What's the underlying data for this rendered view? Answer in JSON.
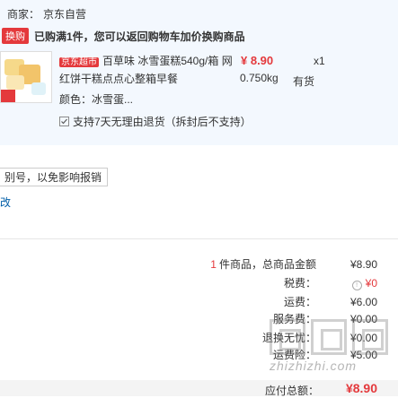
{
  "merchant": {
    "label": "商家：",
    "name": "京东自营"
  },
  "promo": {
    "badge": "换购",
    "text": "已购满1件，您可以返回购物车加价换购商品"
  },
  "product": {
    "store_badge": "京东超市",
    "title": "百草味 冰雪蛋糕540g/箱 网红饼干糕点点心整箱早餐",
    "price": "¥ 8.90",
    "quantity": "x1",
    "weight": "0.750kg",
    "stock": "有货",
    "color_label": "颜色：",
    "color_value": "冰雪蛋...",
    "return_policy": "支持7天无理由退货（拆封后不支持）"
  },
  "invoice": {
    "note": "别号，以免影响报销",
    "more": "改"
  },
  "summary": {
    "items_count": "1",
    "items_label": "件商品，总商品金额",
    "items_amount": "¥8.90",
    "tax_label": "税费：",
    "tax_amount": "¥0",
    "shipping_label": "运费：",
    "shipping_amount": "¥6.00",
    "service_label": "服务费：",
    "service_amount": "¥0.00",
    "return_label": "退换无忧：",
    "return_amount": "¥0.00",
    "return_shipping_label": "运费险：",
    "return_shipping_amount": "¥5.00",
    "total_label": "应付总额：",
    "total_amount": "¥8.90"
  },
  "watermark": {
    "url": "zhizhizhi.com"
  },
  "colors": {
    "accent": "#e4393c",
    "panel": "#f3f8fe",
    "link": "#005ea7"
  }
}
